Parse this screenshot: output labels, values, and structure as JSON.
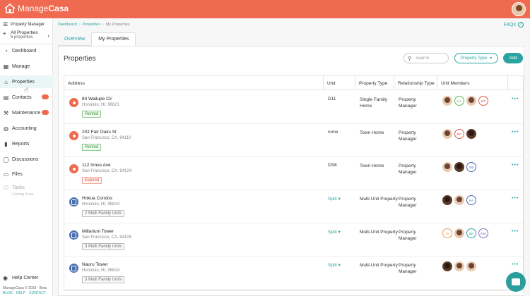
{
  "app": {
    "logo_light": "Manage",
    "logo_bold": "Casa"
  },
  "sidebar": {
    "role": "Property Manager",
    "all_title": "All Properties",
    "all_count": "6 properties",
    "items": [
      {
        "label": "Dashboard",
        "icon": "speedometer-icon"
      },
      {
        "label": "Manage",
        "icon": "grid-icon"
      },
      {
        "label": "Properties",
        "icon": "house-icon"
      },
      {
        "label": "Contacts",
        "icon": "contacts-icon"
      },
      {
        "label": "Maintenance",
        "icon": "wrench-icon"
      },
      {
        "label": "Accounting",
        "icon": "dollar-icon"
      },
      {
        "label": "Reports",
        "icon": "bar-chart-icon"
      },
      {
        "label": "Discussions",
        "icon": "chat-bubble-icon"
      },
      {
        "label": "Files",
        "icon": "folder-icon"
      },
      {
        "label": "Tasks",
        "icon": "checklist-icon"
      }
    ],
    "coming_soon": "Coming Soon",
    "help": "Help Center",
    "copyright": "ManageCasa © 2019 - Beta",
    "links": [
      "BLOG",
      "HELP",
      "CONTACT"
    ]
  },
  "breadcrumb": {
    "dashboard": "Dashboard",
    "properties": "Properties",
    "current": "My Properties"
  },
  "faqs": "FAQs",
  "tabs": [
    "Overview",
    "My Properties"
  ],
  "page": {
    "title": "Properties",
    "search_placeholder": "Search",
    "property_type": "Property Type",
    "add": "Add"
  },
  "table": {
    "headers": [
      "Address",
      "Unit",
      "Property Type",
      "Relationship Type",
      "Unit Members"
    ],
    "rows": [
      {
        "name": "84 Wailupe Cir",
        "city": "Honolulu, HI, 96821",
        "status": "Rented",
        "status_kind": "rented",
        "unit": "D11",
        "type": "Single Family Home",
        "relationship": "Property Manager",
        "members": [
          {
            "kind": "photo"
          },
          {
            "kind": "ini",
            "text": "KA",
            "color": "#5cb85c"
          },
          {
            "kind": "photo"
          },
          {
            "kind": "ini",
            "text": "MT",
            "color": "#e05a44"
          }
        ]
      },
      {
        "name": "202 Fair Oaks St",
        "city": "San Francisco, CA, 94110",
        "status": "Rented",
        "status_kind": "rented",
        "unit": "none",
        "type": "Town Home",
        "relationship": "Property Manager",
        "members": [
          {
            "kind": "photo"
          },
          {
            "kind": "ini",
            "text": "BR",
            "color": "#e05a44"
          },
          {
            "kind": "dark"
          }
        ]
      },
      {
        "name": "112 Innes Ave",
        "city": "San Francisco, CA, 94124",
        "status": "Expired",
        "status_kind": "expired",
        "unit": "DS8",
        "type": "Town Home",
        "relationship": "Property Manager",
        "members": [
          {
            "kind": "photo"
          },
          {
            "kind": "dark"
          },
          {
            "kind": "ini",
            "text": "GB",
            "color": "#4a6fb0"
          }
        ]
      },
      {
        "name": "Hokua Condos",
        "city": "Honolulu, HI, 96814",
        "status": "2 Multi Family Units",
        "status_kind": "units",
        "unit": "Split",
        "type": "Multi-Unit Property",
        "relationship": "Property Manager",
        "members": [
          {
            "kind": "dark"
          },
          {
            "kind": "photo"
          },
          {
            "kind": "ini",
            "text": "KA",
            "color": "#4a6fb0"
          }
        ]
      },
      {
        "name": "Millarium Tower",
        "city": "San Francisco, CA, 94105",
        "status": "3 Multi Family Units",
        "status_kind": "units",
        "unit": "Split",
        "type": "Multi-Unit Property",
        "relationship": "Property Manager",
        "members": [
          {
            "kind": "ini",
            "text": "JR",
            "color": "#e8a050"
          },
          {
            "kind": "photo"
          },
          {
            "kind": "ini",
            "text": "BR",
            "color": "#2aa3a3"
          },
          {
            "kind": "ini",
            "text": "MM",
            "color": "#8a6fc0"
          }
        ]
      },
      {
        "name": "Nauru Tower",
        "city": "Honolulu, HI, 96814",
        "status": "3 Multi Family Units",
        "status_kind": "units",
        "unit": "Split",
        "type": "Multi-Unit Property",
        "relationship": "Property Manager",
        "members": [
          {
            "kind": "dark"
          },
          {
            "kind": "photo"
          },
          {
            "kind": "photo"
          }
        ]
      }
    ]
  }
}
